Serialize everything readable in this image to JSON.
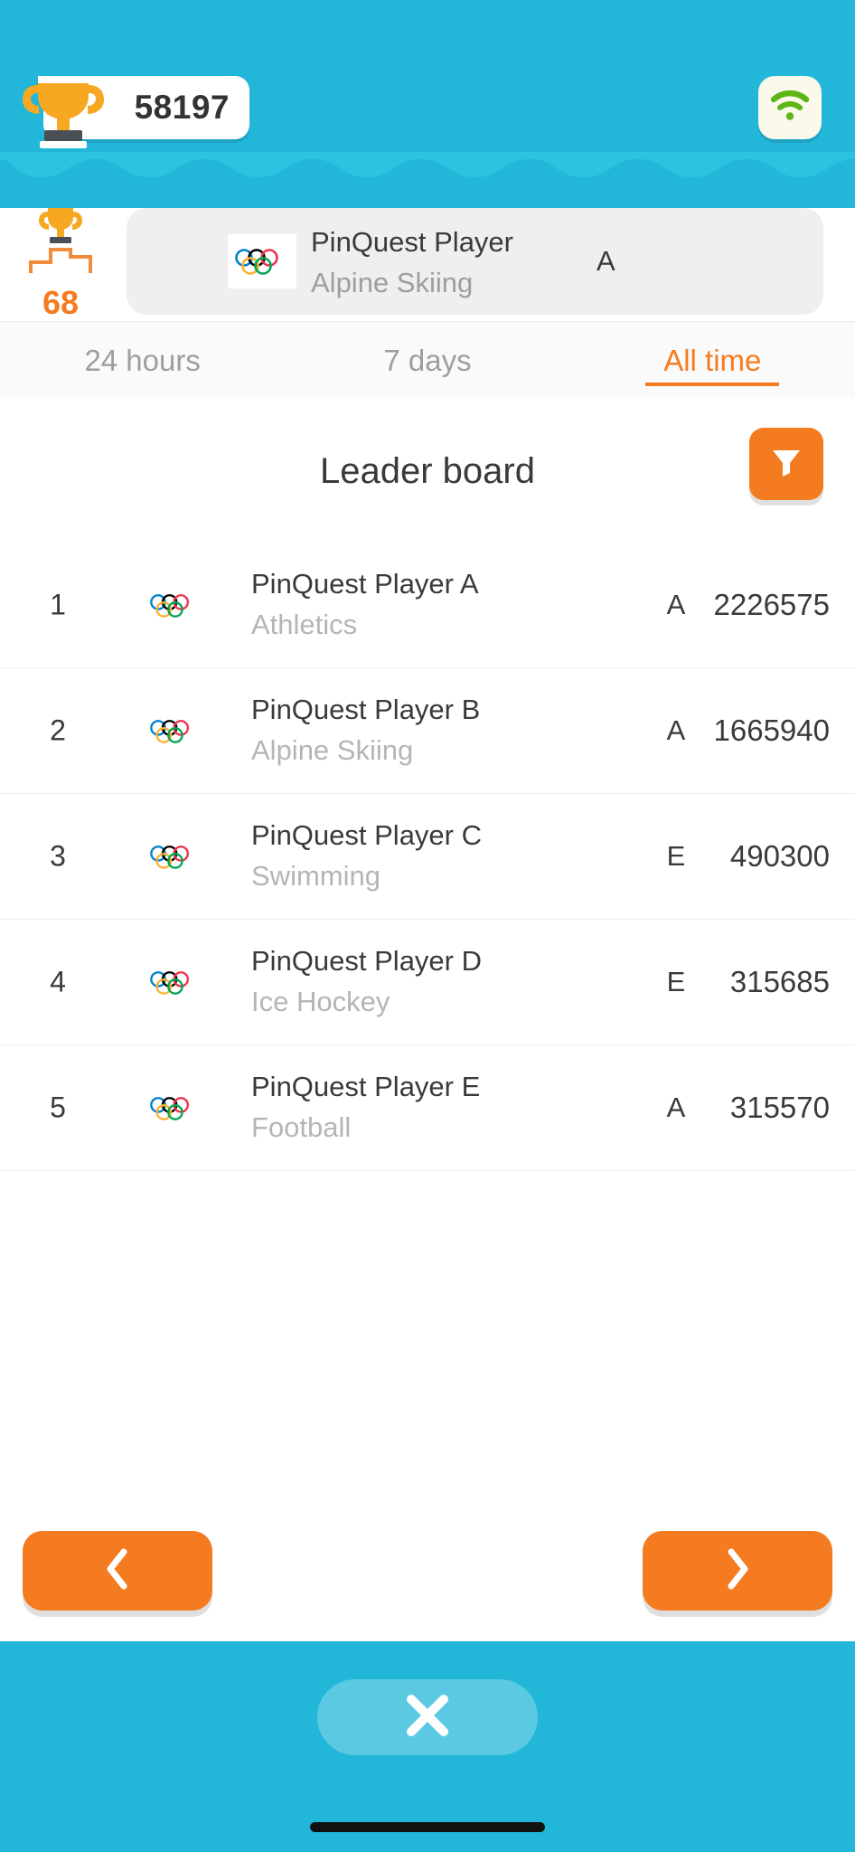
{
  "colors": {
    "header_blue": "#22b7d8",
    "accent_orange": "#f47b20",
    "wifi_green": "#5cb615",
    "trophy_gold": "#f7a823",
    "text_dark": "#3a3a3a",
    "text_muted": "#9e9e9e",
    "card_grey": "#efefef"
  },
  "header": {
    "score": "58197",
    "trophy_icon": "trophy-icon",
    "wifi_icon": "wifi-icon"
  },
  "my_rank": {
    "rank": "68",
    "podium_icon": "podium-trophy-icon",
    "rings_icon": "olympic-rings-icon",
    "player_name": "PinQuest Player",
    "sport": "Alpine Skiing",
    "grade": "A"
  },
  "tabs": [
    {
      "label": "24 hours",
      "active": false
    },
    {
      "label": "7 days",
      "active": false
    },
    {
      "label": "All time",
      "active": true
    }
  ],
  "leaderboard": {
    "title": "Leader board",
    "filter_icon": "filter-funnel-icon",
    "rows": [
      {
        "rank": "1",
        "name": "PinQuest Player A",
        "sport": "Athletics",
        "grade": "A",
        "score": "2226575",
        "flag_icon": "olympic-rings-icon"
      },
      {
        "rank": "2",
        "name": "PinQuest Player B",
        "sport": "Alpine Skiing",
        "grade": "A",
        "score": "1665940",
        "flag_icon": "olympic-rings-icon"
      },
      {
        "rank": "3",
        "name": "PinQuest Player C",
        "sport": "Swimming",
        "grade": "E",
        "score": "490300",
        "flag_icon": "olympic-rings-icon"
      },
      {
        "rank": "4",
        "name": "PinQuest Player D",
        "sport": "Ice Hockey",
        "grade": "E",
        "score": "315685",
        "flag_icon": "olympic-rings-icon"
      },
      {
        "rank": "5",
        "name": "PinQuest Player E",
        "sport": "Football",
        "grade": "A",
        "score": "315570",
        "flag_icon": "olympic-rings-icon"
      }
    ],
    "prev_icon": "chevron-left-icon",
    "next_icon": "chevron-right-icon"
  },
  "bottom": {
    "close_icon": "close-x-icon"
  }
}
